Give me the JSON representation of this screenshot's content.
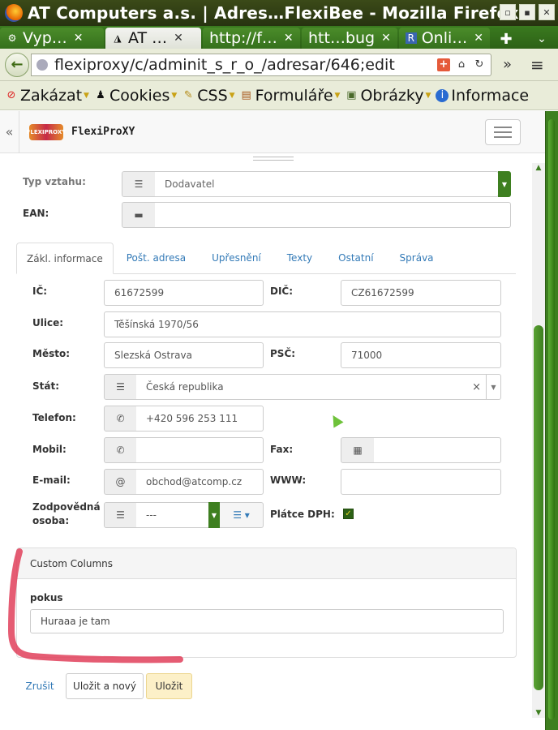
{
  "window": {
    "title": "AT Computers a.s. | Adres…FlexiBee - Mozilla Firefox",
    "controls": [
      "▫",
      "▪",
      "✕"
    ]
  },
  "tabs": [
    {
      "label": "Vyp…",
      "icon": "puzzle-icon"
    },
    {
      "label": "AT …",
      "icon": "flexibee-icon",
      "active": true
    },
    {
      "label": "http://f…",
      "icon": ""
    },
    {
      "label": "htt…bug",
      "icon": ""
    },
    {
      "label": "Onli…",
      "icon": "r-icon"
    }
  ],
  "nav": {
    "url": "flexiproxy/c/adminit_s_r_o_/adresar/646;edit"
  },
  "bookmarks": [
    {
      "label": "Zakázat",
      "icon": "no-icon"
    },
    {
      "label": "Cookies",
      "icon": "person-icon"
    },
    {
      "label": "CSS",
      "icon": "wand-icon"
    },
    {
      "label": "Formuláře",
      "icon": "clipboard-icon"
    },
    {
      "label": "Obrázky",
      "icon": "image-icon"
    },
    {
      "label": "Informace",
      "icon": "info-icon"
    }
  ],
  "app": {
    "brand": "FlexiProXY",
    "logo_text": "FLEXIPROXY"
  },
  "form": {
    "typ_vztahu_label": "Typ vztahu:",
    "typ_vztahu_value": "Dodavatel",
    "ean_label": "EAN:",
    "ean_value": "",
    "tabs": [
      "Zákl. informace",
      "Pošt. adresa",
      "Upřesnění",
      "Texty",
      "Ostatní",
      "Správa"
    ],
    "ic_label": "IČ:",
    "ic_value": "61672599",
    "dic_label": "DIČ:",
    "dic_value": "CZ61672599",
    "ulice_label": "Ulice:",
    "ulice_value": "Těšínská 1970/56",
    "mesto_label": "Město:",
    "mesto_value": "Slezská Ostrava",
    "psc_label": "PSČ:",
    "psc_value": "71000",
    "stat_label": "Stát:",
    "stat_value": "Česká republika",
    "telefon_label": "Telefon:",
    "telefon_value": "+420 596 253 111",
    "mobil_label": "Mobil:",
    "mobil_value": "",
    "fax_label": "Fax:",
    "fax_value": "",
    "email_label": "E-mail:",
    "email_addon": "@",
    "email_value": "obchod@atcomp.cz",
    "www_label": "WWW:",
    "www_value": "",
    "zodp_label_1": "Zodpovědná",
    "zodp_label_2": "osoba:",
    "zodp_value": "---",
    "platce_label": "Plátce DPH:",
    "platce_checked": true
  },
  "custom": {
    "heading": "Custom Columns",
    "field_label": "pokus",
    "field_value": "Huraaa je tam"
  },
  "buttons": {
    "cancel": "Zrušit",
    "save_new": "Uložit a nový",
    "save": "Uložit"
  },
  "colors": {
    "link": "#337ab7",
    "save_bg": "#fcf0c8",
    "annotation": "#e0405a"
  }
}
